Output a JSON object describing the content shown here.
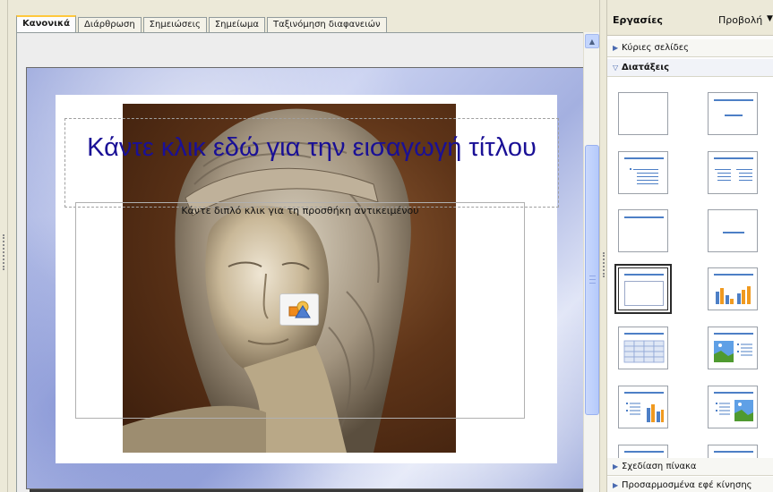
{
  "tabs": [
    {
      "label": "Κανονικά",
      "active": true
    },
    {
      "label": "Διάρθρωση",
      "active": false
    },
    {
      "label": "Σημειώσεις",
      "active": false
    },
    {
      "label": "Σημείωμα",
      "active": false
    },
    {
      "label": "Ταξινόμηση διαφανειών",
      "active": false
    }
  ],
  "slide": {
    "title_placeholder": "Κάντε κλικ εδώ για την εισαγωγή τίτλου",
    "content_placeholder": "Κάντε διπλό κλικ για τη προσθήκη αντικειμένου",
    "insert_object_icon": "insert-object-icon"
  },
  "taskpane": {
    "title": "Εργασίες",
    "view_menu": "Προβολή",
    "sections": [
      {
        "label": "Κύριες σελίδες",
        "expanded": false
      },
      {
        "label": "Διατάξεις",
        "expanded": true
      },
      {
        "label": "Σχεδίαση πίνακα",
        "expanded": false
      },
      {
        "label": "Προσαρμοσμένα εφέ κίνησης",
        "expanded": false
      }
    ],
    "layouts": [
      {
        "name": "blank"
      },
      {
        "name": "title-only-centered"
      },
      {
        "name": "title-content"
      },
      {
        "name": "title-two-columns"
      },
      {
        "name": "title-only"
      },
      {
        "name": "centered-text"
      },
      {
        "name": "title-object",
        "selected": true
      },
      {
        "name": "title-chart"
      },
      {
        "name": "title-table"
      },
      {
        "name": "title-image-text"
      },
      {
        "name": "title-text-chart"
      },
      {
        "name": "title-text-image"
      },
      {
        "name": "title-4"
      },
      {
        "name": "title-5"
      }
    ]
  },
  "colors": {
    "title_text": "#1a1096",
    "layout_accent": "#4d7fc6",
    "active_tab_accent": "#ffc83c"
  }
}
